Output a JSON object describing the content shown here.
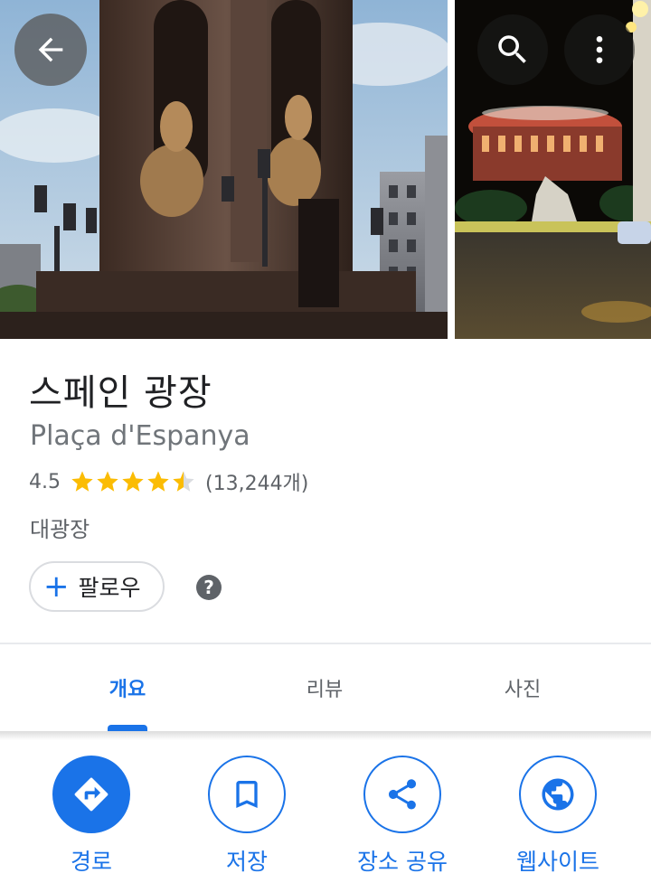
{
  "place": {
    "title": "스페인 광장",
    "subtitle": "Plaça d'Espanya",
    "rating": "4.5",
    "rating_stars": 4.5,
    "review_count": "(13,244개)",
    "category": "대광장"
  },
  "follow": {
    "label": "팔로우"
  },
  "help": {
    "symbol": "?"
  },
  "tabs": [
    {
      "label": "개요",
      "active": true
    },
    {
      "label": "리뷰",
      "active": false
    },
    {
      "label": "사진",
      "active": false
    }
  ],
  "actions": [
    {
      "label": "경로",
      "icon": "directions-icon"
    },
    {
      "label": "저장",
      "icon": "bookmark-icon"
    },
    {
      "label": "장소 공유",
      "icon": "share-icon"
    },
    {
      "label": "웹사이트",
      "icon": "globe-icon"
    }
  ],
  "colors": {
    "accent": "#1a73e8",
    "star": "#fbbc04",
    "text_primary": "#202124",
    "text_secondary": "#5f6368"
  }
}
